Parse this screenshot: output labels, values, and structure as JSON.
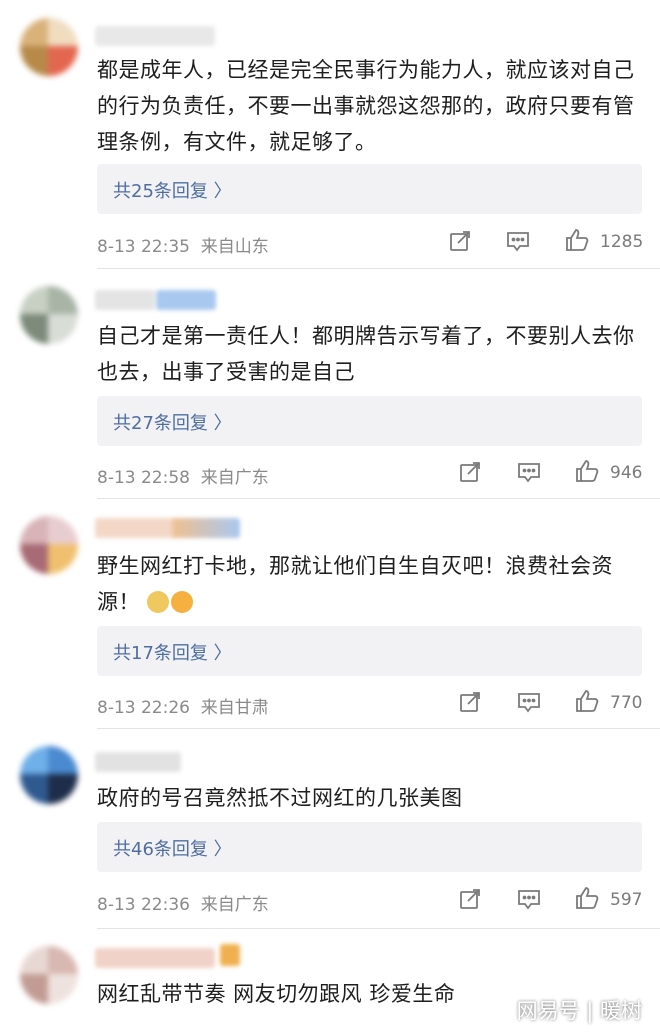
{
  "comments": [
    {
      "text": "都是成年人，已经是完全民事行为能力人，就应该对自己的行为负责任，不要一出事就怨这怨那的，政府只要有管理条例，有文件，就足够了。",
      "reply_label": "共25条回复 〉",
      "time": "8-13 22:35",
      "location": "来自山东",
      "likes": "1285"
    },
    {
      "text": "自己才是第一责任人！都明牌告示写着了，不要别人去你也去，出事了受害的是自己",
      "reply_label": "共27条回复 〉",
      "time": "8-13 22:58",
      "location": "来自广东",
      "likes": "946"
    },
    {
      "text": "野生网红打卡地，那就让他们自生自灭吧！浪费社会资源！",
      "reply_label": "共17条回复 〉",
      "time": "8-13 22:26",
      "location": "来自甘肃",
      "likes": "770"
    },
    {
      "text": "政府的号召竟然抵不过网红的几张美图",
      "reply_label": "共46条回复 〉",
      "time": "8-13 22:36",
      "location": "来自广东",
      "likes": "597"
    },
    {
      "text": "网红乱带节奏 网友切勿跟风 珍爱生命"
    }
  ],
  "icons": {
    "share": "share-icon",
    "comment": "comment-icon",
    "like": "thumbs-up-icon"
  },
  "watermark": "网易号 | 暖树",
  "colors": {
    "link": "#4e6ea1",
    "meta": "#8a8a8a",
    "reply_bg": "#f2f2f4"
  }
}
